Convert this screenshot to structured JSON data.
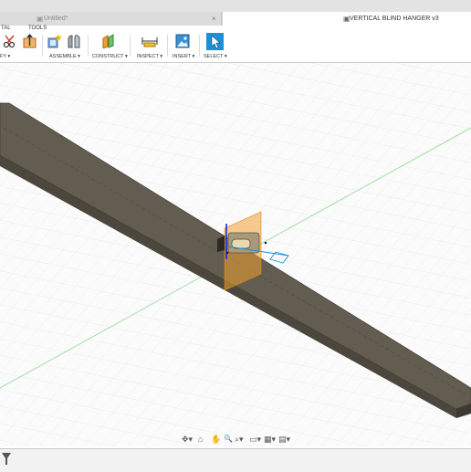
{
  "tabs": {
    "inactive_label": "Untitled*",
    "active_label": "VERTICAL BLIND HANGER v3",
    "close_glyph": "×"
  },
  "workspace_tabs": {
    "left_partial": "TAL",
    "tools": "TOOLS"
  },
  "toolbar": {
    "modify": "FY ▾",
    "assemble": "ASSEMBLE ▾",
    "construct": "CONSTRUCT ▾",
    "inspect": "INSPECT ▾",
    "insert": "INSERT ▾",
    "select": "SELECT ▾"
  },
  "icons": {
    "modify_icon": "scissors-icon",
    "press_pull_icon": "press-pull-icon",
    "assemble_icon": "new-component-icon",
    "joint_icon": "joint-icon",
    "construct_icon": "offset-plane-icon",
    "inspect_icon": "measure-icon",
    "insert_icon": "insert-image-icon",
    "select_icon": "select-cursor-icon"
  },
  "navbar": {
    "orbit": "✥▾",
    "look": "⌂",
    "pan": "✋",
    "zoom": "🔍",
    "fit": "⌕▾",
    "display": "▭▾",
    "grid": "▦▾",
    "viewports": "▤▾"
  },
  "colors": {
    "bar_body": "#5a5448",
    "bar_top": "#6f6a5e",
    "accent_blue": "#1e90d6",
    "plane_orange": "#f0a030",
    "axis_green": "#6fcf6f"
  }
}
